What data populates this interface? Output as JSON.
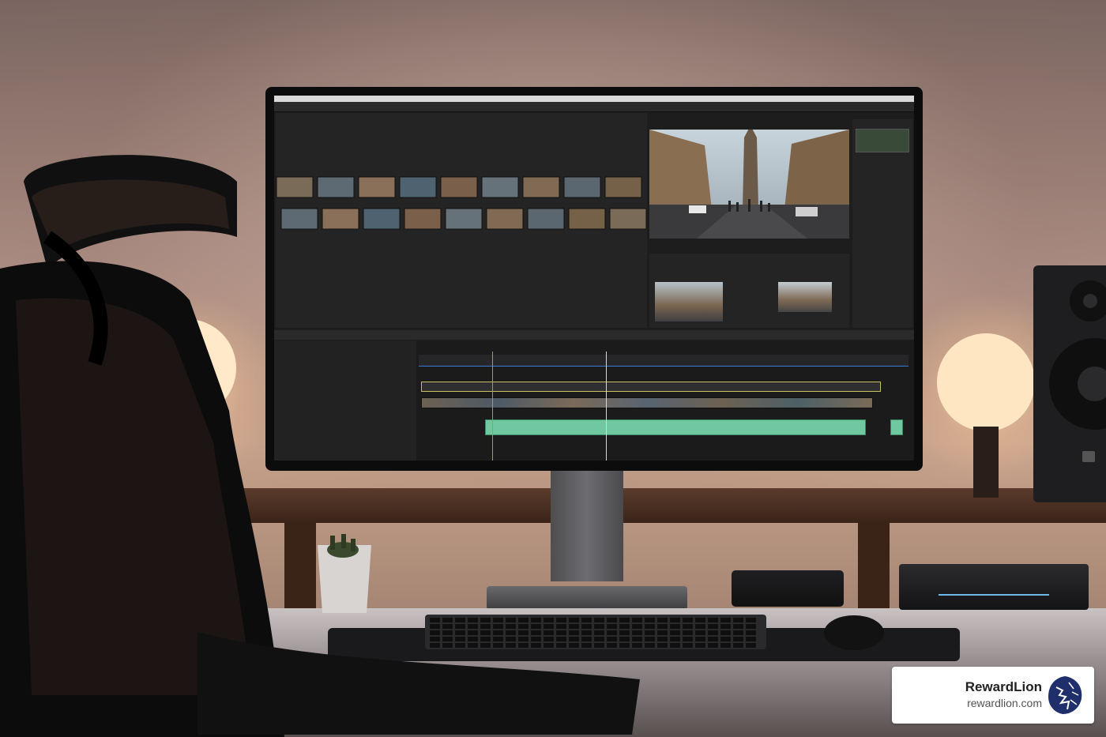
{
  "brand": {
    "name": "RewardLion",
    "url": "rewardlion.com",
    "color": "#1f2f6b"
  },
  "colors": {
    "screen_bg": "#1d1d1e",
    "audio_track": "#6fc8a0",
    "accent_blue": "#3a7bd5"
  },
  "icons": [
    "lion-logo-icon",
    "lamp-icon",
    "speaker-icon",
    "keyboard-icon",
    "mouse-icon"
  ]
}
